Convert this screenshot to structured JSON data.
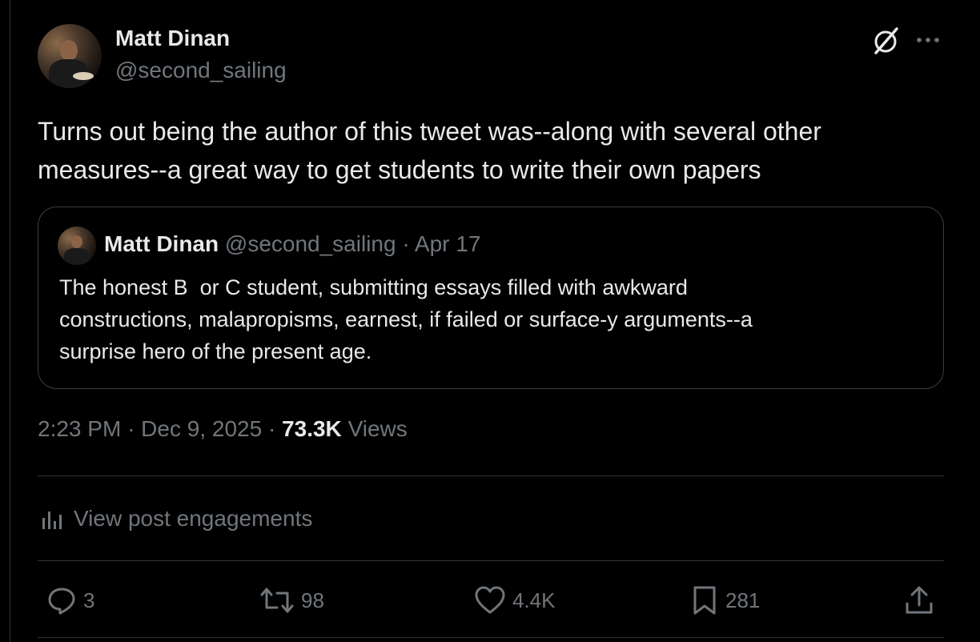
{
  "author": {
    "name": "Matt Dinan",
    "handle": "@second_sailing"
  },
  "tweet": {
    "text": "Turns out being the author of this tweet was--along with several other measures--a great way to get students to write their own papers"
  },
  "quoted": {
    "name": "Matt Dinan",
    "handle": "@second_sailing",
    "separator": "·",
    "date": "Apr 17",
    "text": "The honest B  or C student, submitting essays filled with awkward\nconstructions, malapropisms, earnest, if failed or surface-y arguments--a\nsurprise hero of the present age."
  },
  "meta": {
    "time": "2:23 PM",
    "separator": "·",
    "date": "Dec 9, 2025",
    "separator2": "·",
    "views_count": "73.3K",
    "views_label": "Views"
  },
  "engagements": {
    "label": "View post engagements"
  },
  "actions": {
    "replies": "3",
    "reposts": "98",
    "likes": "4.4K",
    "bookmarks": "281"
  },
  "icons": {
    "top_right": [
      "grok-icon",
      "more-icon"
    ],
    "actions": [
      "reply-icon",
      "repost-icon",
      "like-icon",
      "bookmark-icon",
      "share-icon"
    ],
    "engagements": "bar-chart-icon"
  },
  "colors": {
    "background": "#000000",
    "text_primary": "#e7e9ea",
    "text_secondary": "#71767b",
    "border": "#2f3336"
  }
}
